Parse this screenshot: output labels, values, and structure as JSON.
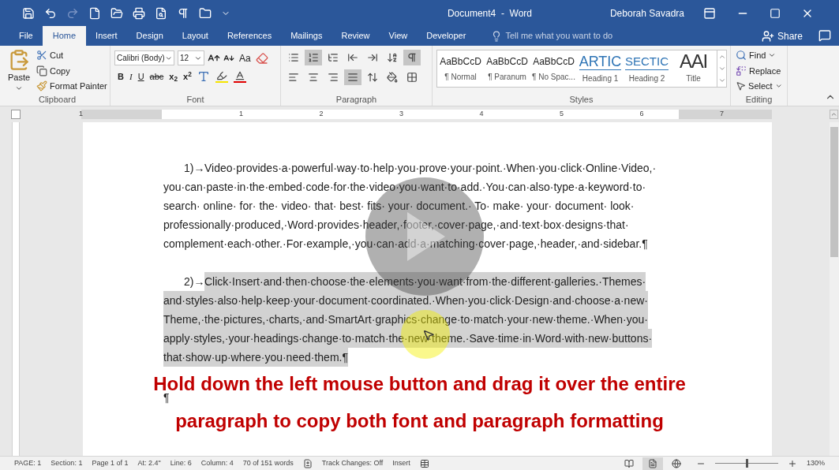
{
  "window": {
    "title": "Document4  -  Word",
    "user": "Deborah Savadra"
  },
  "tabs": [
    {
      "label": "File",
      "selected": false
    },
    {
      "label": "Home",
      "selected": true
    },
    {
      "label": "Insert",
      "selected": false
    },
    {
      "label": "Design",
      "selected": false
    },
    {
      "label": "Layout",
      "selected": false
    },
    {
      "label": "References",
      "selected": false
    },
    {
      "label": "Mailings",
      "selected": false
    },
    {
      "label": "Review",
      "selected": false
    },
    {
      "label": "View",
      "selected": false
    },
    {
      "label": "Developer",
      "selected": false
    }
  ],
  "tell_me": {
    "placeholder": "Tell me what you want to do"
  },
  "share": "Share",
  "clipboard": {
    "paste": "Paste",
    "cut": "Cut",
    "copy": "Copy",
    "format_painter": "Format Painter",
    "label": "Clipboard"
  },
  "font": {
    "name": "Calibri (Body)",
    "size": "12",
    "change_case": "Aa",
    "label": "Font",
    "format_buttons": [
      {
        "kind": "bold",
        "label": "B"
      },
      {
        "kind": "italic",
        "label": "I"
      },
      {
        "kind": "underline",
        "label": "U"
      },
      {
        "kind": "strike",
        "label": "abc"
      },
      {
        "kind": "sub",
        "label": "x$_{2}$"
      },
      {
        "kind": "sup",
        "label": "x$^{2}$"
      }
    ]
  },
  "paragraph": {
    "label": "Paragraph",
    "row1": [
      {
        "kind": "bullets",
        "selected": false
      },
      {
        "kind": "numbering",
        "selected": true
      },
      {
        "kind": "multilevel",
        "selected": false
      },
      {
        "kind": "outdent",
        "selected": false
      },
      {
        "kind": "indent",
        "selected": false
      },
      {
        "kind": "sort",
        "selected": false
      },
      {
        "kind": "marks",
        "selected": true
      }
    ],
    "row2": [
      {
        "kind": "left",
        "selected": false
      },
      {
        "kind": "center",
        "selected": false
      },
      {
        "kind": "right",
        "selected": false
      },
      {
        "kind": "justify",
        "selected": true
      },
      {
        "kind": "spacing",
        "selected": false
      },
      {
        "kind": "shading",
        "selected": false
      },
      {
        "kind": "borders",
        "selected": false
      }
    ]
  },
  "styles": {
    "label": "Styles",
    "items": [
      {
        "kind": "normal",
        "sample": "AaBbCcD",
        "name": "¶ Normal"
      },
      {
        "kind": "normal",
        "sample": "AaBbCcD",
        "name": "¶ Paranum"
      },
      {
        "kind": "normal",
        "sample": "AaBbCcD",
        "name": "¶ No Spac..."
      },
      {
        "kind": "heading1",
        "sample": "ARTIC",
        "name": "Heading 1"
      },
      {
        "kind": "heading2",
        "sample": "SECTIC",
        "name": "Heading 2"
      },
      {
        "kind": "title",
        "sample": "AAI",
        "name": "Title"
      }
    ]
  },
  "editing": {
    "label": "Editing",
    "find": "Find",
    "replace": "Replace",
    "select": "Select"
  },
  "ruler": {
    "labels": [
      "1",
      "1",
      "2",
      "3",
      "4",
      "5",
      "6",
      "7"
    ]
  },
  "document": {
    "paragraphs": [
      {
        "marker": "1)→",
        "selected": false,
        "lines": [
          "Video·provides·a·powerful·way·to·help·you·prove·your·point.·When·you·click·Online·Video,·",
          "you·can·paste·in·the·embed·code·for·the·video·you·want·to·add.·You·can·also·type·a·keyword·to·",
          "search· online· for· the· video· that· best· fits· your· document.· To· make· your· document· look·",
          "professionally·produced,·Word·provides·header,·footer,·cover·page,·and·text·box·designs·that·",
          "complement·each·other.·For·example,·you·can·add·a·matching·cover·page,·header,·and·sidebar.¶"
        ]
      },
      {
        "marker": "2)→",
        "selected": true,
        "lines": [
          "Click·Insert·and·then·choose·the·elements·you·want·from·the·different·galleries.·Themes·",
          "and·styles·also·help·keep·your·document·coordinated.·When·you·click·Design·and·choose·a·new·",
          "Theme,·the·pictures,·charts,·and·SmartArt·graphics·change·to·match·your·new·theme.·When·you·",
          "apply·styles,·your·headings·change·to·match·the·new·theme.·Save·time·in·Word·with·new·buttons·",
          "that·show·up·where·you·need·them.¶"
        ]
      }
    ],
    "empty_mark": "¶"
  },
  "caption": [
    "Hold down the left mouse button and drag it over the entire",
    "paragraph to copy both font and paragraph formatting"
  ],
  "status_bar": {
    "items": [
      "PAGE: 1",
      "Section: 1",
      "Page 1 of 1",
      "At: 2.4\"",
      "Line: 6",
      "Column: 4",
      "70 of 151 words"
    ],
    "track_changes": "Track Changes: Off",
    "mode": "Insert",
    "views": [
      {
        "kind": "read",
        "selected": false
      },
      {
        "kind": "print",
        "selected": true
      },
      {
        "kind": "web",
        "selected": false
      }
    ],
    "zoom": {
      "level": 0.5,
      "reading": "130%"
    }
  }
}
